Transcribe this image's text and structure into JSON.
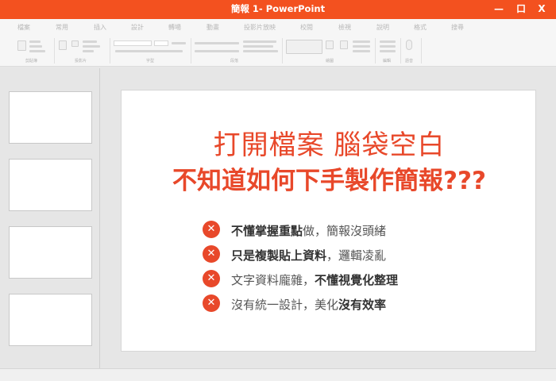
{
  "window": {
    "title": "簡報 1- PowerPoint",
    "minimize_label": "—",
    "restore_label": "口",
    "close_label": "X"
  },
  "ribbon": {
    "tabs": [
      "檔案",
      "常用",
      "插入",
      "設計",
      "轉場",
      "動畫",
      "投影片放映",
      "校閱",
      "檢視",
      "說明",
      "格式",
      "搜尋"
    ],
    "groups": [
      "剪貼簿",
      "投影片",
      "字型",
      "段落",
      "繪圖",
      "編輯",
      "語音"
    ]
  },
  "slide": {
    "title_line1": "打開檔案 腦袋空白",
    "title_line2": "不知道如何下手製作簡報???",
    "bullets": [
      {
        "bold": "不懂掌握重點",
        "normal": "做，簡報沒頭緒"
      },
      {
        "bold": "只是複製貼上資料",
        "normal": "，邏輯凌亂"
      },
      {
        "normal": "文字資料龐雜，",
        "bold": "不懂視覺化整理"
      },
      {
        "normal": "沒有統一設計，美化",
        "bold": "沒有效率"
      }
    ],
    "bullet_icon": "x-circle-icon"
  },
  "colors": {
    "accent": "#f3511f",
    "slide_text": "#e8482a"
  }
}
